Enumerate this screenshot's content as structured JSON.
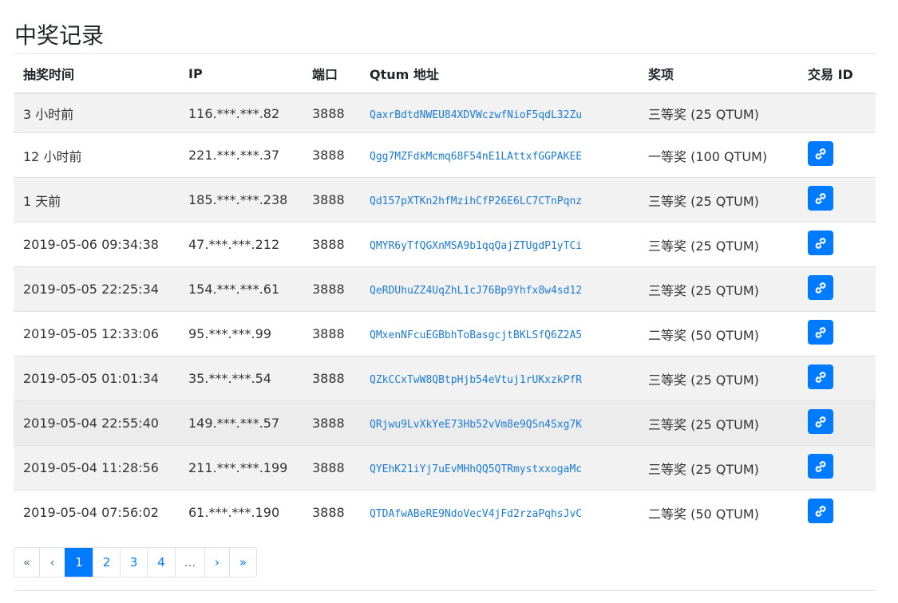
{
  "page_title": "中奖记录",
  "columns": [
    "抽奖时间",
    "IP",
    "端口",
    "Qtum 地址",
    "奖项",
    "交易 ID"
  ],
  "rows": [
    {
      "time": "3 小时前",
      "ip": "116.***.***.82",
      "port": "3888",
      "address": "QaxrBdtdNWEU84XDVWczwfNioF5qdL32Zu",
      "prize": "三等奖 (25 QTUM)",
      "has_tx": false
    },
    {
      "time": "12 小时前",
      "ip": "221.***.***.37",
      "port": "3888",
      "address": "Qgg7MZFdkMcmq68F54nE1LAttxfGGPAKEE",
      "prize": "一等奖 (100 QTUM)",
      "has_tx": true
    },
    {
      "time": "1 天前",
      "ip": "185.***.***.238",
      "port": "3888",
      "address": "Qd157pXTKn2hfMzihCfP26E6LC7CTnPqnz",
      "prize": "三等奖 (25 QTUM)",
      "has_tx": true
    },
    {
      "time": "2019-05-06 09:34:38",
      "ip": "47.***.***.212",
      "port": "3888",
      "address": "QMYR6yTfQGXnMSA9b1qqQajZTUgdP1yTCi",
      "prize": "三等奖 (25 QTUM)",
      "has_tx": true
    },
    {
      "time": "2019-05-05 22:25:34",
      "ip": "154.***.***.61",
      "port": "3888",
      "address": "QeRDUhuZZ4UqZhL1cJ76Bp9Yhfx8w4sd12",
      "prize": "三等奖 (25 QTUM)",
      "has_tx": true
    },
    {
      "time": "2019-05-05 12:33:06",
      "ip": "95.***.***.99",
      "port": "3888",
      "address": "QMxenNFcuEGBbhToBasgcjtBKLSfQ6Z2A5",
      "prize": "二等奖 (50 QTUM)",
      "has_tx": true
    },
    {
      "time": "2019-05-05 01:01:34",
      "ip": "35.***.***.54",
      "port": "3888",
      "address": "QZkCCxTwW8QBtpHjb54eVtuj1rUKxzkPfR",
      "prize": "三等奖 (25 QTUM)",
      "has_tx": true
    },
    {
      "time": "2019-05-04 22:55:40",
      "ip": "149.***.***.57",
      "port": "3888",
      "address": "QRjwu9LvXkYeE73Hb52vVm8e9QSn4Sxg7K",
      "prize": "三等奖 (25 QTUM)",
      "has_tx": true
    },
    {
      "time": "2019-05-04 11:28:56",
      "ip": "211.***.***.199",
      "port": "3888",
      "address": "QYEhK21iYj7uEvMHhQQ5QTRmystxxogaMc",
      "prize": "三等奖 (25 QTUM)",
      "has_tx": true
    },
    {
      "time": "2019-05-04 07:56:02",
      "ip": "61.***.***.190",
      "port": "3888",
      "address": "QTDAfwABeRE9NdoVecV4jFd2rzaPqhsJvC",
      "prize": "二等奖 (50 QTUM)",
      "has_tx": true
    }
  ],
  "link_icon": "link-icon",
  "pagination": {
    "items": [
      {
        "label": "«",
        "state": "muted"
      },
      {
        "label": "‹",
        "state": "muted"
      },
      {
        "label": "1",
        "state": "active"
      },
      {
        "label": "2",
        "state": "normal"
      },
      {
        "label": "3",
        "state": "normal"
      },
      {
        "label": "4",
        "state": "normal"
      },
      {
        "label": "...",
        "state": "muted"
      },
      {
        "label": "›",
        "state": "normal"
      },
      {
        "label": "»",
        "state": "normal"
      }
    ]
  },
  "colors": {
    "accent": "#007bff",
    "address": "#1a7bd6",
    "stripe": "#f2f2f2"
  }
}
